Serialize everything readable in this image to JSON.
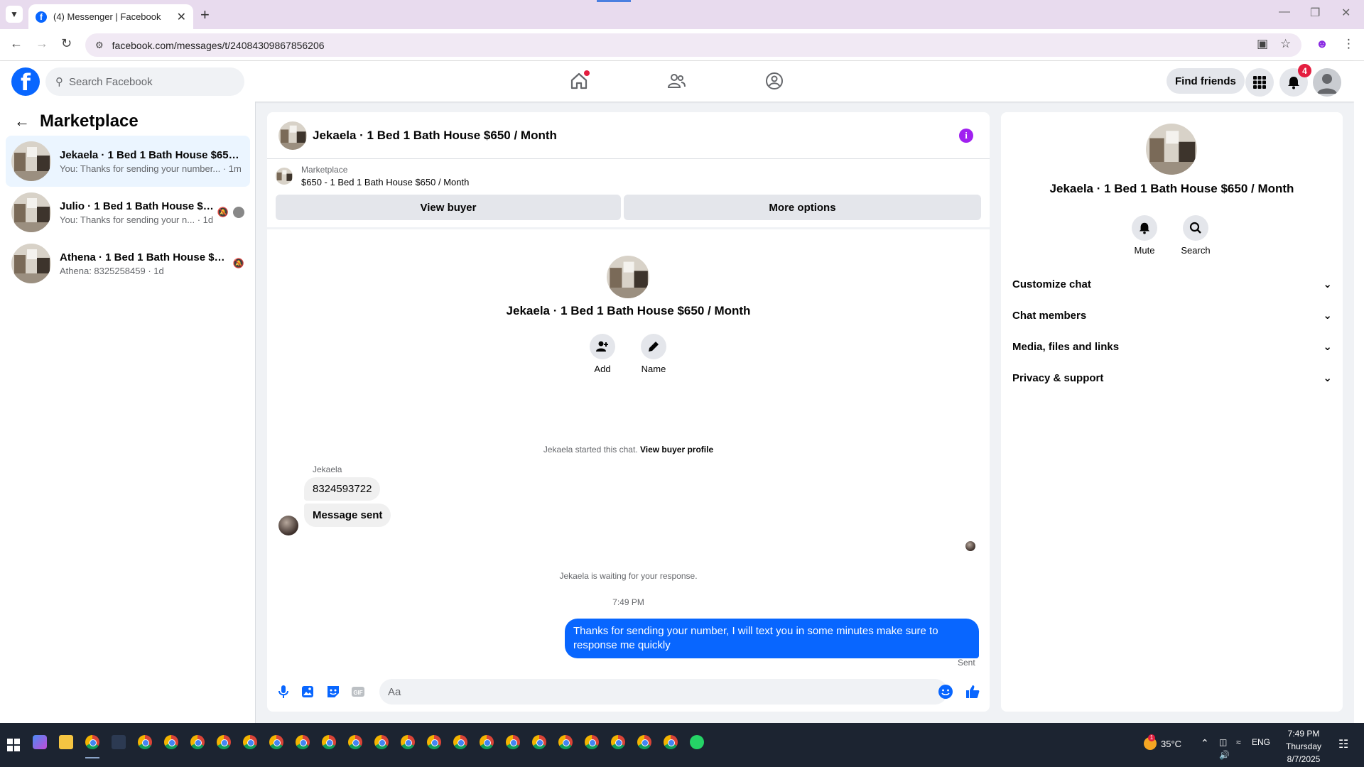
{
  "browser": {
    "tab_title": "(4) Messenger | Facebook",
    "url": "facebook.com/messages/t/24084309867856206"
  },
  "header": {
    "search_placeholder": "Search Facebook",
    "find_friends": "Find friends",
    "notification_count": "4"
  },
  "left": {
    "title": "Marketplace",
    "conversations": [
      {
        "name": "Jekaela · 1 Bed 1 Bath House $650 ...",
        "preview": "You: Thanks for sending your number...",
        "time": "1m"
      },
      {
        "name": "Julio · 1 Bed 1 Bath House $6...",
        "preview": "You: Thanks for sending your n...",
        "time": "1d"
      },
      {
        "name": "Athena · 1 Bed 1 Bath House $65...",
        "preview": "Athena: 8325258459",
        "time": "1d"
      }
    ]
  },
  "chat": {
    "title": "Jekaela · 1 Bed 1 Bath House $650 / Month",
    "listing_source": "Marketplace",
    "listing_title": "$650 - 1 Bed 1 Bath House $650 / Month",
    "view_buyer": "View buyer",
    "more_options": "More options",
    "profile_title": "Jekaela · 1 Bed 1 Bath House $650 / Month",
    "add_label": "Add",
    "name_label": "Name",
    "started_text": "Jekaela started this chat.",
    "view_buyer_profile": "View buyer profile",
    "sender_name": "Jekaela",
    "incoming": [
      "8324593722",
      "Message sent"
    ],
    "waiting_text": "Jekaela is waiting for your response.",
    "timestamp": "7:49 PM",
    "outgoing": "Thanks for sending your number, I will text you in some minutes make sure to response me quickly",
    "sent_status": "Sent",
    "composer_placeholder": "Aa",
    "gif_label": "GIF"
  },
  "right": {
    "title": "Jekaela · 1 Bed 1 Bath House $650 / Month",
    "mute": "Mute",
    "search": "Search",
    "sections": [
      "Customize chat",
      "Chat members",
      "Media, files and links",
      "Privacy & support"
    ]
  },
  "taskbar": {
    "temperature": "35°C",
    "language": "ENG",
    "time": "7:49 PM",
    "day": "Thursday",
    "date": "8/7/2025",
    "weather_alert": "1"
  },
  "colors": {
    "fb_blue": "#0866ff",
    "badge_red": "#e41e3f",
    "info_purple": "#a020f0"
  }
}
